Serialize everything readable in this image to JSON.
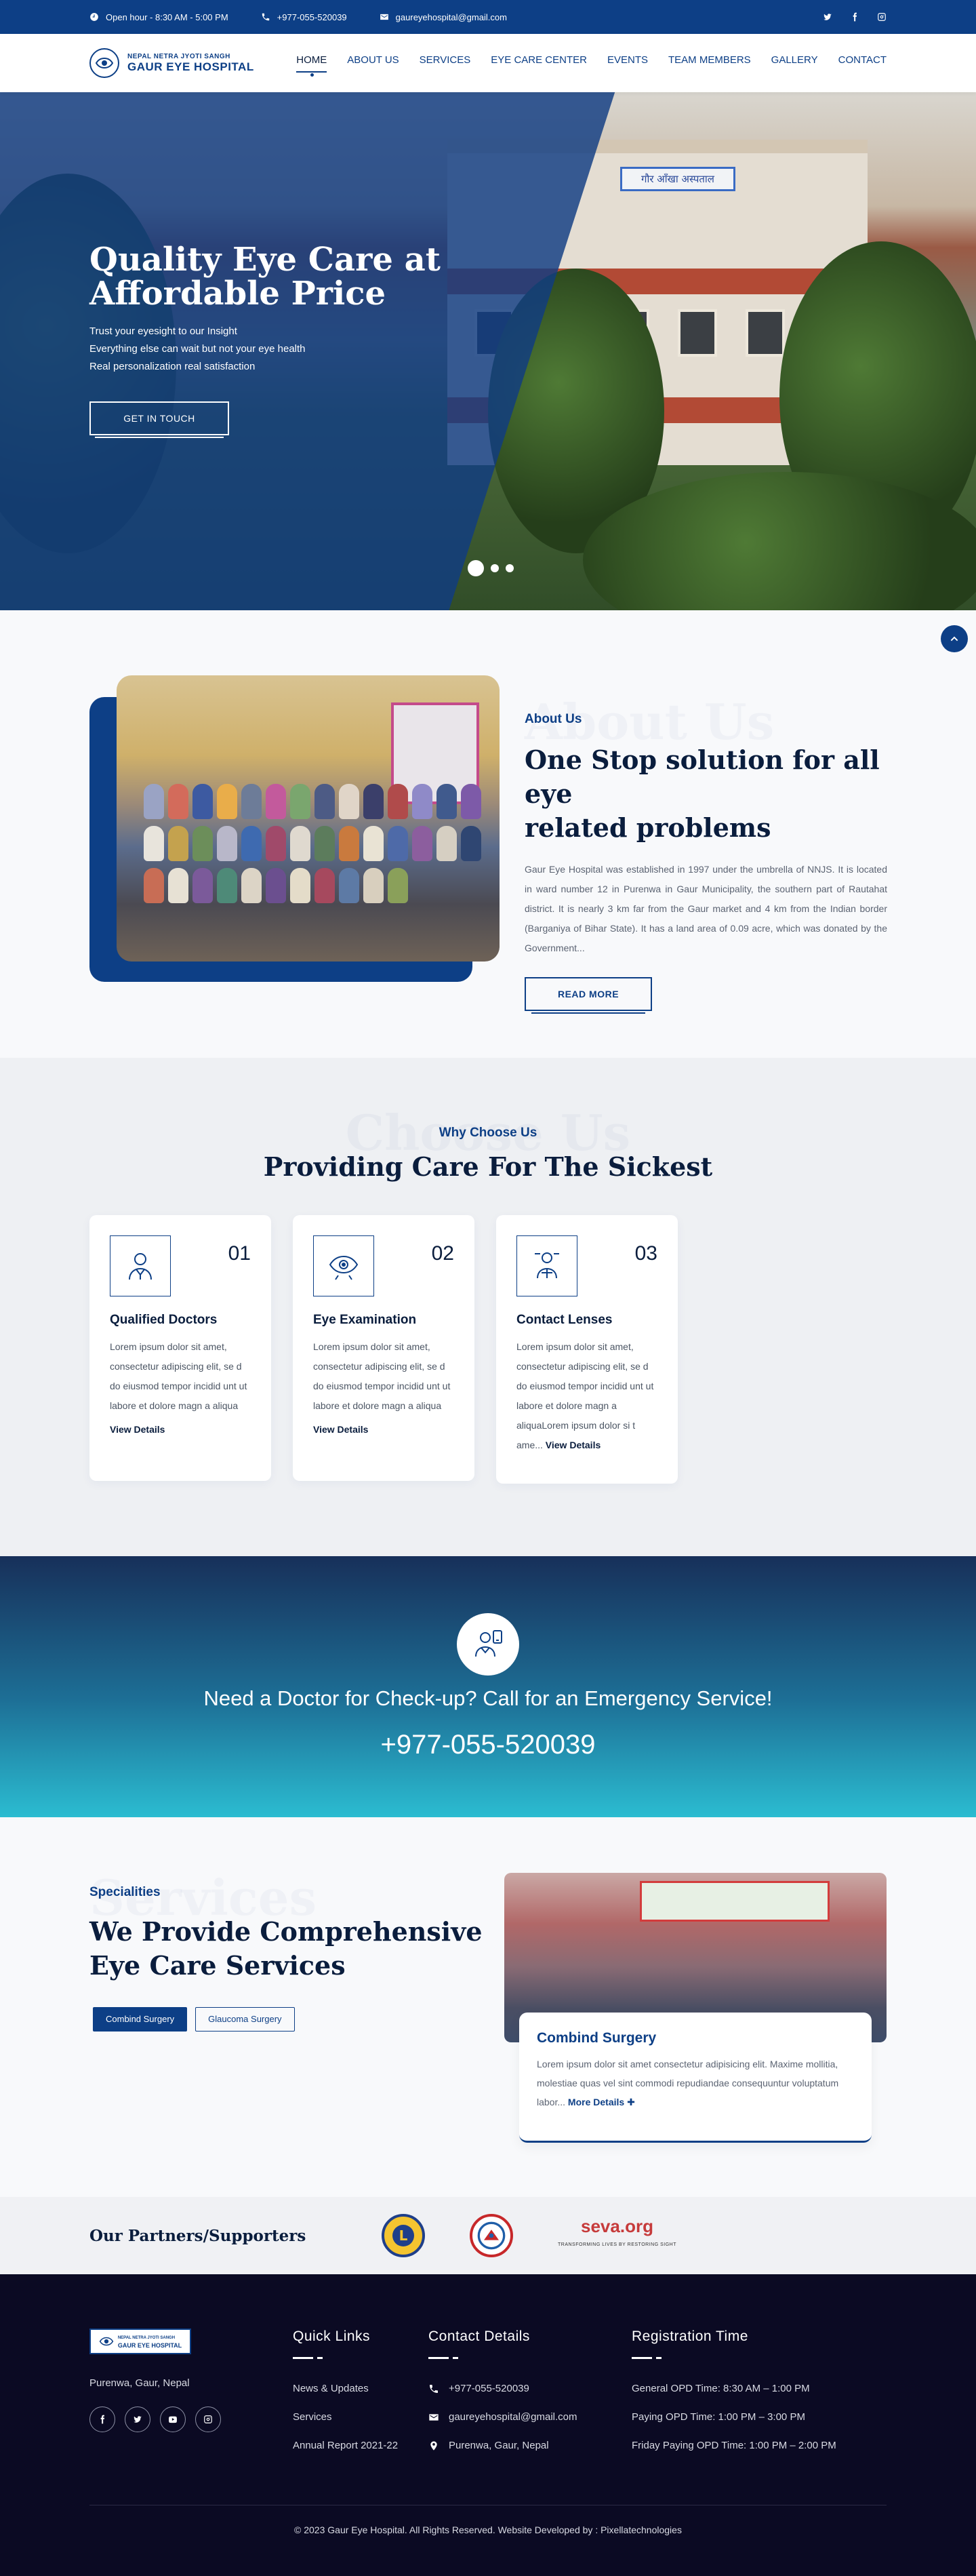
{
  "topbar": {
    "hours": "Open hour - 8:30 AM - 5:00 PM",
    "phone": "+977-055-520039",
    "email": "gaureyehospital@gmail.com",
    "socials": [
      "twitter-icon",
      "facebook-icon",
      "instagram-icon"
    ]
  },
  "brand": {
    "small": "NEPAL NETRA JYOTI SANGH",
    "name": "GAUR EYE HOSPITAL"
  },
  "nav": [
    "HOME",
    "ABOUT US",
    "SERVICES",
    "EYE CARE CENTER",
    "EVENTS",
    "TEAM MEMBERS",
    "GALLERY",
    "CONTACT"
  ],
  "hero": {
    "title_line1": "Quality Eye Care at",
    "title_line2": "Affordable Price",
    "line1": "Trust your eyesight to our Insight",
    "line2": "Everything else can wait but not your eye health",
    "line3": "Real personalization real satisfaction",
    "cta": "GET IN TOUCH",
    "sign": "गौर आँखा अस्पताल"
  },
  "about": {
    "ghost": "About Us",
    "eyebrow": "About Us",
    "title_line1": "One Stop solution for all eye",
    "title_line2": "related problems",
    "body": "Gaur Eye Hospital was established in 1997 under the umbrella of NNJS. It is located in ward number 12 in Purenwa in Gaur Municipality, the southern part of Rautahat district. It is nearly 3 km far from the Gaur market and 4 km from the Indian border (Barganiya of Bihar State). It has a land area of 0.09 acre, which was donated by the Government...",
    "cta": "READ MORE"
  },
  "why": {
    "ghost": "Choose Us",
    "eyebrow": "Why Choose Us",
    "title": "Providing Care For The Sickest",
    "cards": [
      {
        "num": "01",
        "title": "Qualified Doctors",
        "body": "Lorem ipsum dolor sit amet, consectetur adipiscing elit, se d do eiusmod tempor incidid unt ut labore et dolore magn a aliqua",
        "more": "View Details"
      },
      {
        "num": "02",
        "title": "Eye Examination",
        "body": "Lorem ipsum dolor sit amet, consectetur adipiscing elit, se d do eiusmod tempor incidid unt ut labore et dolore magn a aliqua",
        "more": "View Details"
      },
      {
        "num": "03",
        "title": "Contact Lenses",
        "body": "Lorem ipsum dolor sit amet, consectetur adipiscing elit, se d do eiusmod tempor incidid unt ut labore et dolore magn a aliquaLorem ipsum dolor si t ame...",
        "more": "View Details"
      }
    ]
  },
  "emergency": {
    "title": "Need a Doctor for Check-up? Call for an Emergency Service!",
    "phone": "+977-055-520039"
  },
  "services": {
    "ghost": "Services",
    "eyebrow": "Specialities",
    "title_line1": "We Provide Comprehensive",
    "title_line2": "Eye Care Services",
    "tabs": [
      "Combind Surgery",
      "Glaucoma Surgery"
    ],
    "card_title": "Combind Surgery",
    "card_body": "Lorem ipsum dolor sit amet consectetur adipisicing elit. Maxime mollitia, molestiae quas vel sint commodi repudiandae consequuntur voluptatum labor...",
    "card_more": "More Details"
  },
  "partners": {
    "title": "Our Partners/Supporters",
    "seva_name": "seva.org",
    "seva_tag": "TRANSFORMING LIVES BY RESTORING SIGHT"
  },
  "footer": {
    "logo_small": "NEPAL NETRA JYOTI SANGH",
    "logo_name": "GAUR EYE HOSPITAL",
    "address": "Purenwa, Gaur, Nepal",
    "quick_title": "Quick Links",
    "quick_links": [
      "News & Updates",
      "Services",
      "Annual Report 2021-22"
    ],
    "contact_title": "Contact Details",
    "contact_phone": "+977-055-520039",
    "contact_email": "gaureyehospital@gmail.com",
    "contact_address": "Purenwa, Gaur, Nepal",
    "reg_title": "Registration Time",
    "reg_times": [
      "General OPD Time: 8:30 AM – 1:00 PM",
      "Paying OPD Time: 1:00 PM – 3:00 PM",
      "Friday Paying OPD Time: 1:00 PM – 2:00 PM"
    ],
    "copyright": "© 2023 Gaur Eye Hospital. All Rights Reserved. Website Developed by : Pixellatechnologies"
  }
}
